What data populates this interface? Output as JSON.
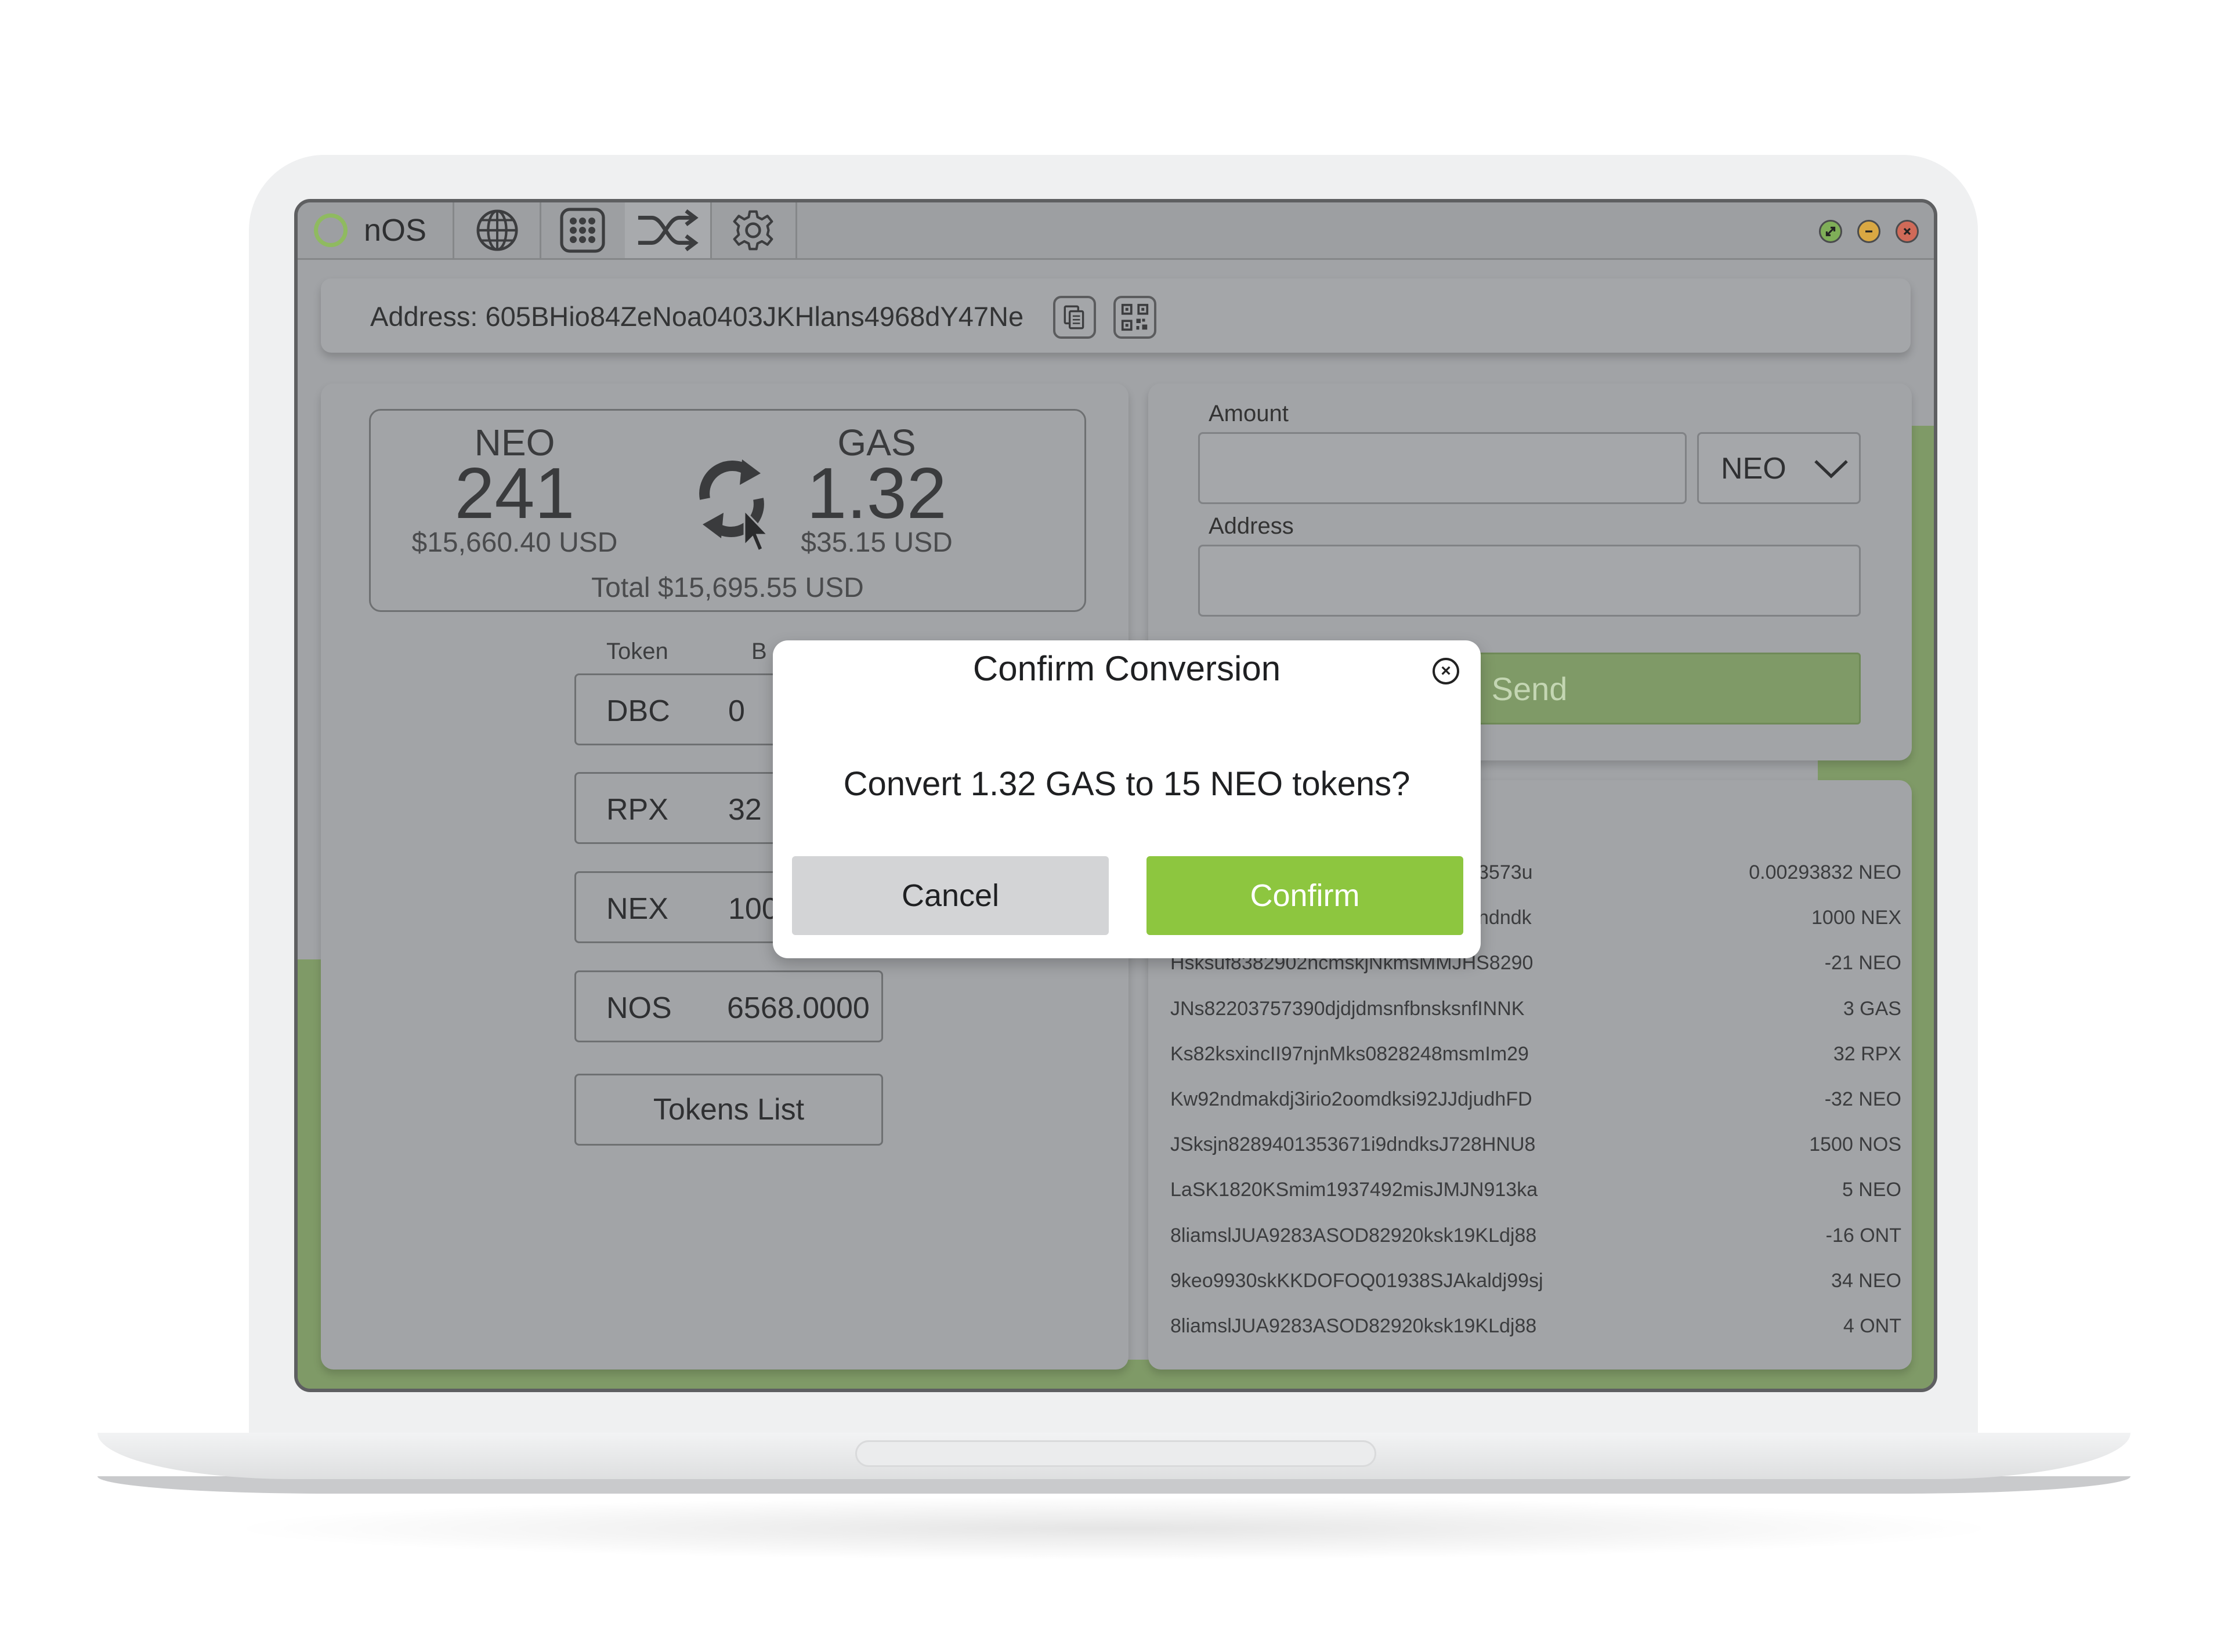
{
  "app": {
    "name": "nOS"
  },
  "tabs": [
    {
      "icon": "globe-icon"
    },
    {
      "icon": "apps-grid-icon"
    },
    {
      "icon": "shuffle-icon",
      "active": true
    },
    {
      "icon": "gear-icon"
    }
  ],
  "window_controls": [
    "maximize",
    "minimize",
    "close"
  ],
  "wallet": {
    "address_text": "Address: 605BHio84ZeNoa0403JKHlans4968dY47Ne",
    "copy_icon": "copy-icon",
    "qr_icon": "qr-code-icon"
  },
  "balances": {
    "neo": {
      "label": "NEO",
      "amount": "241",
      "usd": "$15,660.40 USD"
    },
    "gas": {
      "label": "GAS",
      "amount": "1.32",
      "usd": "$35.15 USD"
    },
    "total": "Total $15,695.55 USD",
    "convert_icon": "convert-refresh-icon"
  },
  "tokens": {
    "header_token": "Token",
    "header_balance": "B",
    "rows": [
      {
        "symbol": "DBC",
        "balance": "0"
      },
      {
        "symbol": "RPX",
        "balance": "32"
      },
      {
        "symbol": "NEX",
        "balance": "100"
      },
      {
        "symbol": "NOS",
        "balance": "6568.0000"
      }
    ],
    "list_button": "Tokens List"
  },
  "send": {
    "amount_label": "Amount",
    "asset_selected": "NEO",
    "address_label": "Address",
    "send_label": "Send"
  },
  "transactions": [
    {
      "id": "3573u",
      "amount": "0.00293832 NEO"
    },
    {
      "id": "ndndk",
      "amount": "1000 NEX"
    },
    {
      "id": "Hsksuf8382902ncmskjNkmsMMJHS8290",
      "amount": "-21 NEO"
    },
    {
      "id": "JNs82203757390djdjdmsnfbnsksnfINNK",
      "amount": "3 GAS"
    },
    {
      "id": "Ks82ksxincII97njnMks0828248msmIm29",
      "amount": "32 RPX"
    },
    {
      "id": "Kw92ndmakdj3irio2oomdksi92JJdjudhFD",
      "amount": "-32 NEO"
    },
    {
      "id": "JSksjn8289401353671i9dndksJ728HNU8",
      "amount": "1500 NOS"
    },
    {
      "id": "LaSK1820KSmim1937492misJMJN913ka",
      "amount": "5 NEO"
    },
    {
      "id": "8liamslJUA9283ASOD82920ksk19KLdj88",
      "amount": "-16 ONT"
    },
    {
      "id": "9keo9930skKKDOFOQ01938SJAkaldj99sj",
      "amount": "34 NEO"
    },
    {
      "id": "8liamslJUA9283ASOD82920ksk19KLdj88",
      "amount": "4 ONT"
    }
  ],
  "modal": {
    "title": "Confirm Conversion",
    "message": "Convert 1.32 GAS to 15 NEO tokens?",
    "cancel": "Cancel",
    "confirm": "Confirm"
  },
  "colors": {
    "accent_green": "#8dc63f",
    "muted_green": "#7f9a67",
    "overlay_gray": "#a1a3a6"
  }
}
